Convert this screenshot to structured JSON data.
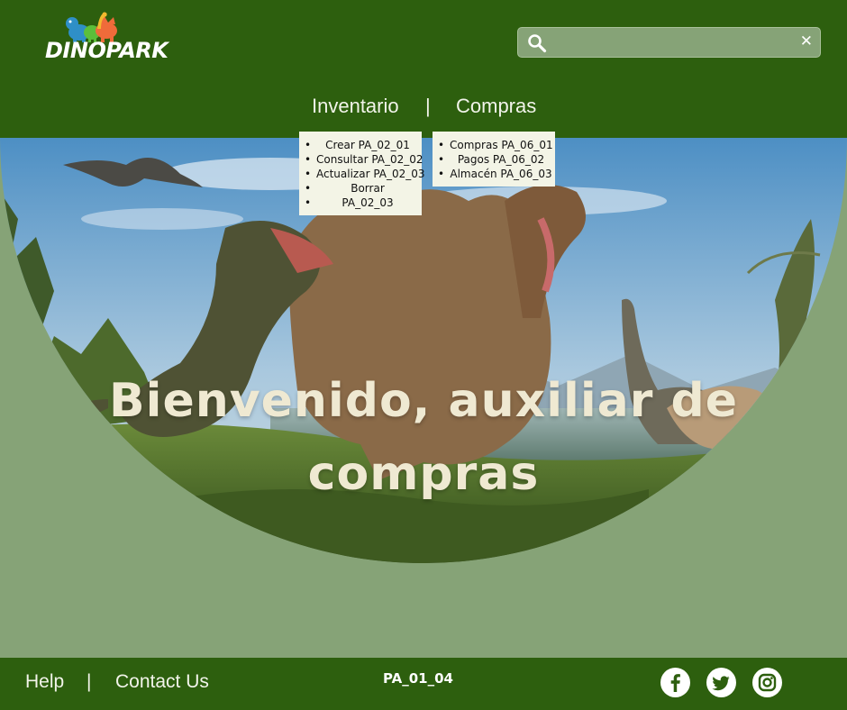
{
  "brand": {
    "name": "DINOPARK"
  },
  "search": {
    "placeholder": "",
    "value": "",
    "clear_label": "✕"
  },
  "nav": {
    "inventario": "Inventario",
    "separator": "|",
    "compras": "Compras"
  },
  "inventario_menu": [
    "Crear PA_02_01",
    "Consultar PA_02_02",
    "Actualizar PA_02_03",
    "Borrar",
    "PA_02_03"
  ],
  "compras_menu": [
    "Compras PA_06_01",
    "Pagos PA_06_02",
    "Almacén PA_06_03"
  ],
  "hero": {
    "line1": "Bienvenido, auxiliar de",
    "line2": "compras"
  },
  "footer": {
    "help": "Help",
    "separator": "|",
    "contact": "Contact Us",
    "page_code": "PA_01_04"
  },
  "icons": {
    "search": "search-icon",
    "facebook": "facebook-icon",
    "twitter": "twitter-icon",
    "instagram": "instagram-icon"
  },
  "colors": {
    "header_bg": "#2d5f0e",
    "page_bg": "#86a377",
    "menu_bg": "#f3f4e6",
    "hero_text": "#efe9d2"
  }
}
